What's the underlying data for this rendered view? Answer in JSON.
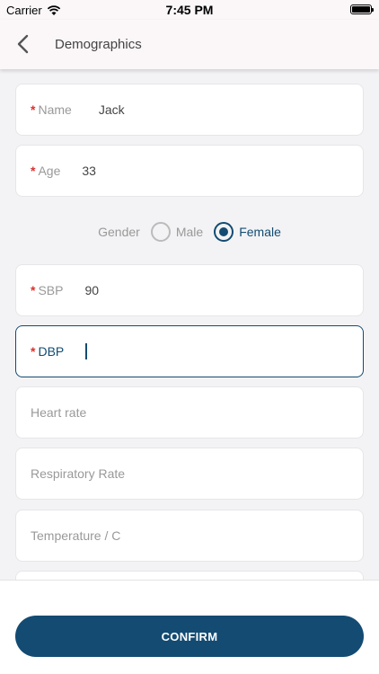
{
  "status_bar": {
    "carrier": "Carrier",
    "time": "7:45 PM"
  },
  "nav": {
    "title": "Demographics"
  },
  "form": {
    "name": {
      "required_mark": "*",
      "label": "Name",
      "value": "Jack"
    },
    "age": {
      "required_mark": "*",
      "label": "Age",
      "value": "33"
    },
    "gender": {
      "label": "Gender",
      "options": [
        "Male",
        "Female"
      ],
      "selected": "Female"
    },
    "sbp": {
      "required_mark": "*",
      "label": "SBP",
      "value": "90"
    },
    "dbp": {
      "required_mark": "*",
      "label": "DBP",
      "value": ""
    },
    "heart_rate": {
      "placeholder": "Heart rate"
    },
    "respiratory_rate": {
      "placeholder": "Respiratory Rate"
    },
    "temperature": {
      "placeholder": "Temperature / C"
    }
  },
  "confirm": {
    "label": "CONFIRM"
  },
  "colors": {
    "primary": "#134b72",
    "required": "#d9332e"
  }
}
